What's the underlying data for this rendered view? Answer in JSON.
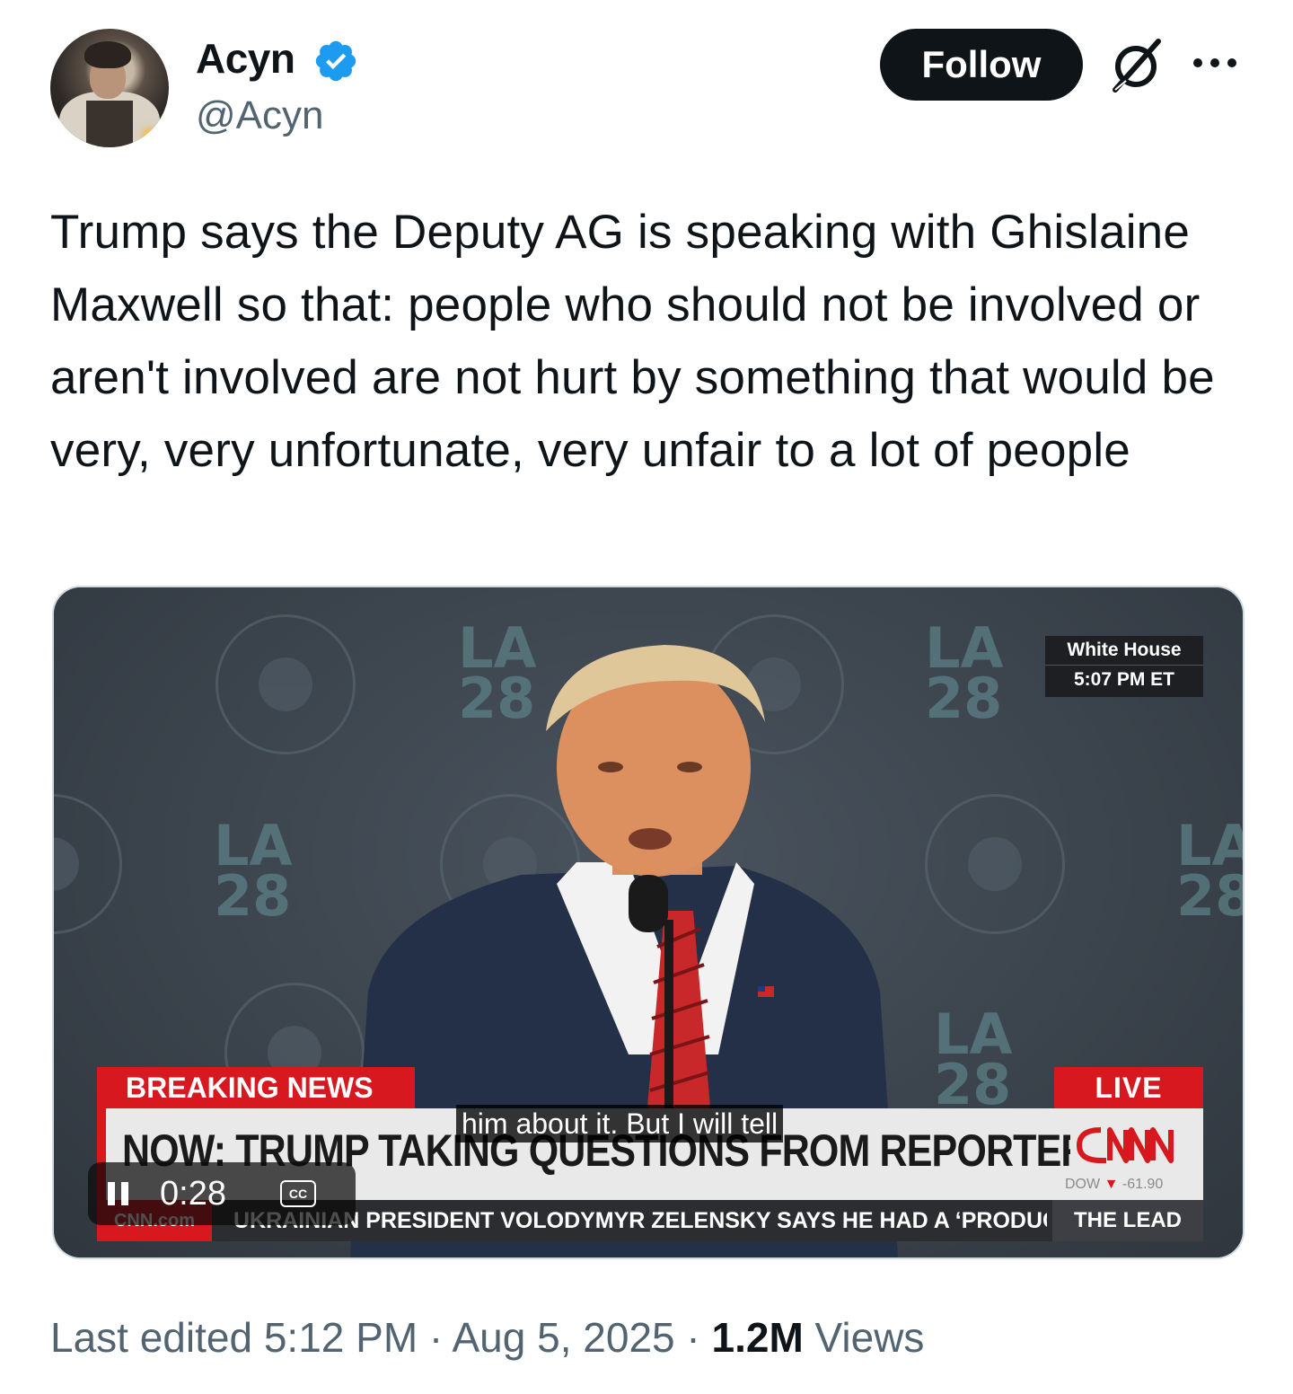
{
  "author": {
    "name": "Acyn",
    "handle": "@Acyn",
    "verified": true
  },
  "actions": {
    "follow_label": "Follow"
  },
  "tweet": {
    "text": "Trump says the Deputy AG is speaking with Ghislaine Maxwell so that: people who should not be involved or aren't involved are not hurt by something that would be very, very unfortunate, very unfair to a lot of people"
  },
  "video": {
    "location_badge": "White House",
    "time_badge": "5:07 PM ET",
    "breaking_label": "BREAKING NEWS",
    "live_label": "LIVE",
    "headline": "NOW: TRUMP TAKING QUESTIONS FROM REPORTERS",
    "network": "CNN",
    "dow_label": "DOW",
    "dow_value": "-61.90",
    "site_label": "CNN.com",
    "ticker": "UKRAINIAN PRESIDENT VOLODYMYR ZELENSKY SAYS HE HAD A ‘PRODUCTIVE",
    "show_name": "THE LEAD",
    "caption": "him about it. But I will tell",
    "player_time": "0:28",
    "cc_label": "CC",
    "backdrop_logo": "LA 28"
  },
  "footer": {
    "edited_prefix": "Last edited ",
    "time": "5:12 PM",
    "separator": " · ",
    "date": "Aug 5, 2025",
    "views_count": "1.2M",
    "views_label": "Views"
  },
  "colors": {
    "follow_bg": "#0f1419",
    "verified": "#1d9bf0",
    "secondary_text": "#536471",
    "cnn_red": "#d8181f"
  }
}
